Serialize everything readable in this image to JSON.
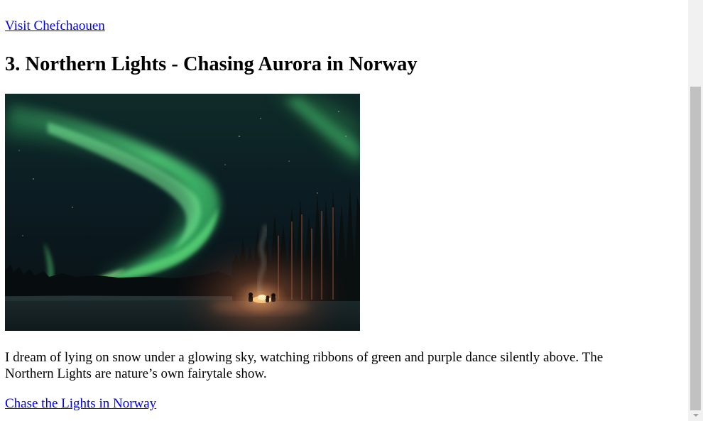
{
  "previous_link": {
    "label": "Visit Chefchaouen"
  },
  "section": {
    "title": "3. Northern Lights - Chasing Aurora in Norway",
    "image_alt": "Aurora borealis over a snowy forest with a campfire",
    "description": "I dream of lying on snow under a glowing sky, watching ribbons of green and purple dance silently above. The Northern Lights are nature’s own fairytale show.",
    "cta_label": "Chase the Lights in Norway"
  },
  "colors": {
    "link": "#0000ee",
    "aurora_green": "#3ed06a",
    "night_sky": "#0d1a22",
    "scrollbar_track": "#f1f1f1",
    "scrollbar_thumb": "#c1c1c1"
  }
}
